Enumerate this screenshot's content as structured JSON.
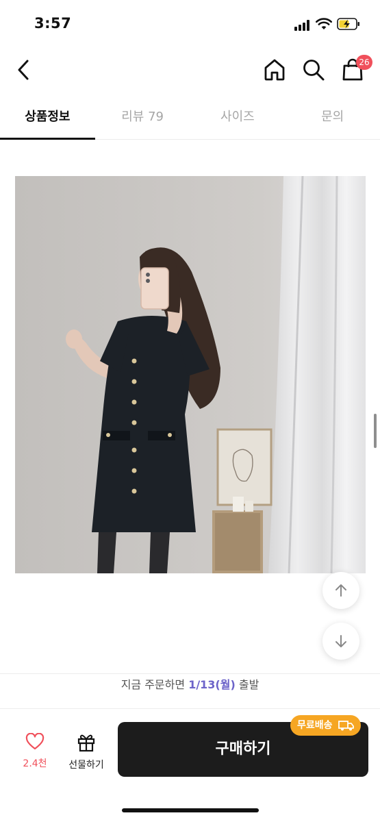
{
  "status_bar": {
    "time": "3:57"
  },
  "nav": {
    "icons": [
      "chevron-left-icon",
      "home-icon",
      "search-icon",
      "shopping-bag-icon"
    ],
    "cart_count": "26"
  },
  "tabs": [
    {
      "label": "상품정보",
      "active": true
    },
    {
      "label": "리뷰 79",
      "active": false
    },
    {
      "label": "사이즈",
      "active": false
    },
    {
      "label": "문의",
      "active": false
    }
  ],
  "shipping": {
    "prefix": "지금 주문하면 ",
    "date": "1/13(월)",
    "suffix": " 출발"
  },
  "bottom": {
    "like_count": "2.4천",
    "gift_label": "선물하기",
    "buy_label": "구매하기",
    "free_shipping_badge": "무료배송"
  },
  "colors": {
    "accent_red": "#f0505b",
    "ship_date": "#6c63c9",
    "badge_orange": "#f6a623",
    "buy_button": "#1c1c1c"
  }
}
